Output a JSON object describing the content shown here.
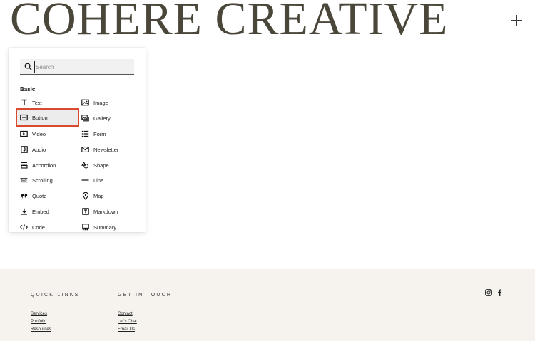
{
  "site": {
    "title": "COHERE CREATIVE"
  },
  "panel": {
    "search": {
      "placeholder": "Search",
      "value": ""
    },
    "section_label": "Basic",
    "selected": "Button",
    "left_items": [
      {
        "label": "Text",
        "icon": "text-icon"
      },
      {
        "label": "Button",
        "icon": "button-icon"
      },
      {
        "label": "Video",
        "icon": "video-icon"
      },
      {
        "label": "Audio",
        "icon": "audio-icon"
      },
      {
        "label": "Accordion",
        "icon": "accordion-icon"
      },
      {
        "label": "Scrolling",
        "icon": "scrolling-icon"
      },
      {
        "label": "Quote",
        "icon": "quote-icon"
      },
      {
        "label": "Embed",
        "icon": "embed-icon"
      },
      {
        "label": "Code",
        "icon": "code-icon"
      }
    ],
    "right_items": [
      {
        "label": "Image",
        "icon": "image-icon"
      },
      {
        "label": "Gallery",
        "icon": "gallery-icon"
      },
      {
        "label": "Form",
        "icon": "form-icon"
      },
      {
        "label": "Newsletter",
        "icon": "newsletter-icon"
      },
      {
        "label": "Shape",
        "icon": "shape-icon"
      },
      {
        "label": "Line",
        "icon": "line-icon"
      },
      {
        "label": "Map",
        "icon": "map-pin-icon"
      },
      {
        "label": "Markdown",
        "icon": "markdown-icon"
      },
      {
        "label": "Summary",
        "icon": "summary-icon"
      }
    ]
  },
  "footer": {
    "quick_links": {
      "heading": "QUICK LINKS",
      "links": [
        "Services",
        "Portfolio",
        "Resources"
      ]
    },
    "get_in_touch": {
      "heading": "GET IN TOUCH",
      "links": [
        "Contact",
        "Let's Chat",
        "Email Us"
      ]
    },
    "social": [
      "instagram-icon",
      "facebook-icon"
    ]
  },
  "colors": {
    "selection_outline": "#d9492e",
    "footer_bg": "#f6f3ef",
    "title": "#4a4639"
  }
}
